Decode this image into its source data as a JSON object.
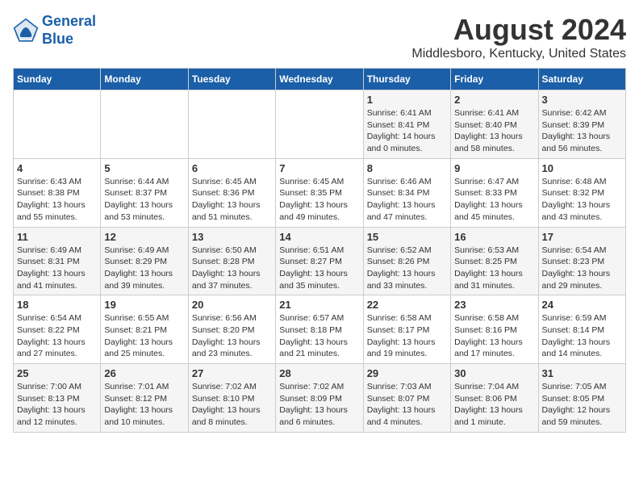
{
  "logo": {
    "line1": "General",
    "line2": "Blue"
  },
  "title": "August 2024",
  "location": "Middlesboro, Kentucky, United States",
  "weekdays": [
    "Sunday",
    "Monday",
    "Tuesday",
    "Wednesday",
    "Thursday",
    "Friday",
    "Saturday"
  ],
  "weeks": [
    [
      {
        "day": "",
        "info": ""
      },
      {
        "day": "",
        "info": ""
      },
      {
        "day": "",
        "info": ""
      },
      {
        "day": "",
        "info": ""
      },
      {
        "day": "1",
        "info": "Sunrise: 6:41 AM\nSunset: 8:41 PM\nDaylight: 14 hours\nand 0 minutes."
      },
      {
        "day": "2",
        "info": "Sunrise: 6:41 AM\nSunset: 8:40 PM\nDaylight: 13 hours\nand 58 minutes."
      },
      {
        "day": "3",
        "info": "Sunrise: 6:42 AM\nSunset: 8:39 PM\nDaylight: 13 hours\nand 56 minutes."
      }
    ],
    [
      {
        "day": "4",
        "info": "Sunrise: 6:43 AM\nSunset: 8:38 PM\nDaylight: 13 hours\nand 55 minutes."
      },
      {
        "day": "5",
        "info": "Sunrise: 6:44 AM\nSunset: 8:37 PM\nDaylight: 13 hours\nand 53 minutes."
      },
      {
        "day": "6",
        "info": "Sunrise: 6:45 AM\nSunset: 8:36 PM\nDaylight: 13 hours\nand 51 minutes."
      },
      {
        "day": "7",
        "info": "Sunrise: 6:45 AM\nSunset: 8:35 PM\nDaylight: 13 hours\nand 49 minutes."
      },
      {
        "day": "8",
        "info": "Sunrise: 6:46 AM\nSunset: 8:34 PM\nDaylight: 13 hours\nand 47 minutes."
      },
      {
        "day": "9",
        "info": "Sunrise: 6:47 AM\nSunset: 8:33 PM\nDaylight: 13 hours\nand 45 minutes."
      },
      {
        "day": "10",
        "info": "Sunrise: 6:48 AM\nSunset: 8:32 PM\nDaylight: 13 hours\nand 43 minutes."
      }
    ],
    [
      {
        "day": "11",
        "info": "Sunrise: 6:49 AM\nSunset: 8:31 PM\nDaylight: 13 hours\nand 41 minutes."
      },
      {
        "day": "12",
        "info": "Sunrise: 6:49 AM\nSunset: 8:29 PM\nDaylight: 13 hours\nand 39 minutes."
      },
      {
        "day": "13",
        "info": "Sunrise: 6:50 AM\nSunset: 8:28 PM\nDaylight: 13 hours\nand 37 minutes."
      },
      {
        "day": "14",
        "info": "Sunrise: 6:51 AM\nSunset: 8:27 PM\nDaylight: 13 hours\nand 35 minutes."
      },
      {
        "day": "15",
        "info": "Sunrise: 6:52 AM\nSunset: 8:26 PM\nDaylight: 13 hours\nand 33 minutes."
      },
      {
        "day": "16",
        "info": "Sunrise: 6:53 AM\nSunset: 8:25 PM\nDaylight: 13 hours\nand 31 minutes."
      },
      {
        "day": "17",
        "info": "Sunrise: 6:54 AM\nSunset: 8:23 PM\nDaylight: 13 hours\nand 29 minutes."
      }
    ],
    [
      {
        "day": "18",
        "info": "Sunrise: 6:54 AM\nSunset: 8:22 PM\nDaylight: 13 hours\nand 27 minutes."
      },
      {
        "day": "19",
        "info": "Sunrise: 6:55 AM\nSunset: 8:21 PM\nDaylight: 13 hours\nand 25 minutes."
      },
      {
        "day": "20",
        "info": "Sunrise: 6:56 AM\nSunset: 8:20 PM\nDaylight: 13 hours\nand 23 minutes."
      },
      {
        "day": "21",
        "info": "Sunrise: 6:57 AM\nSunset: 8:18 PM\nDaylight: 13 hours\nand 21 minutes."
      },
      {
        "day": "22",
        "info": "Sunrise: 6:58 AM\nSunset: 8:17 PM\nDaylight: 13 hours\nand 19 minutes."
      },
      {
        "day": "23",
        "info": "Sunrise: 6:58 AM\nSunset: 8:16 PM\nDaylight: 13 hours\nand 17 minutes."
      },
      {
        "day": "24",
        "info": "Sunrise: 6:59 AM\nSunset: 8:14 PM\nDaylight: 13 hours\nand 14 minutes."
      }
    ],
    [
      {
        "day": "25",
        "info": "Sunrise: 7:00 AM\nSunset: 8:13 PM\nDaylight: 13 hours\nand 12 minutes."
      },
      {
        "day": "26",
        "info": "Sunrise: 7:01 AM\nSunset: 8:12 PM\nDaylight: 13 hours\nand 10 minutes."
      },
      {
        "day": "27",
        "info": "Sunrise: 7:02 AM\nSunset: 8:10 PM\nDaylight: 13 hours\nand 8 minutes."
      },
      {
        "day": "28",
        "info": "Sunrise: 7:02 AM\nSunset: 8:09 PM\nDaylight: 13 hours\nand 6 minutes."
      },
      {
        "day": "29",
        "info": "Sunrise: 7:03 AM\nSunset: 8:07 PM\nDaylight: 13 hours\nand 4 minutes."
      },
      {
        "day": "30",
        "info": "Sunrise: 7:04 AM\nSunset: 8:06 PM\nDaylight: 13 hours\nand 1 minute."
      },
      {
        "day": "31",
        "info": "Sunrise: 7:05 AM\nSunset: 8:05 PM\nDaylight: 12 hours\nand 59 minutes."
      }
    ]
  ]
}
